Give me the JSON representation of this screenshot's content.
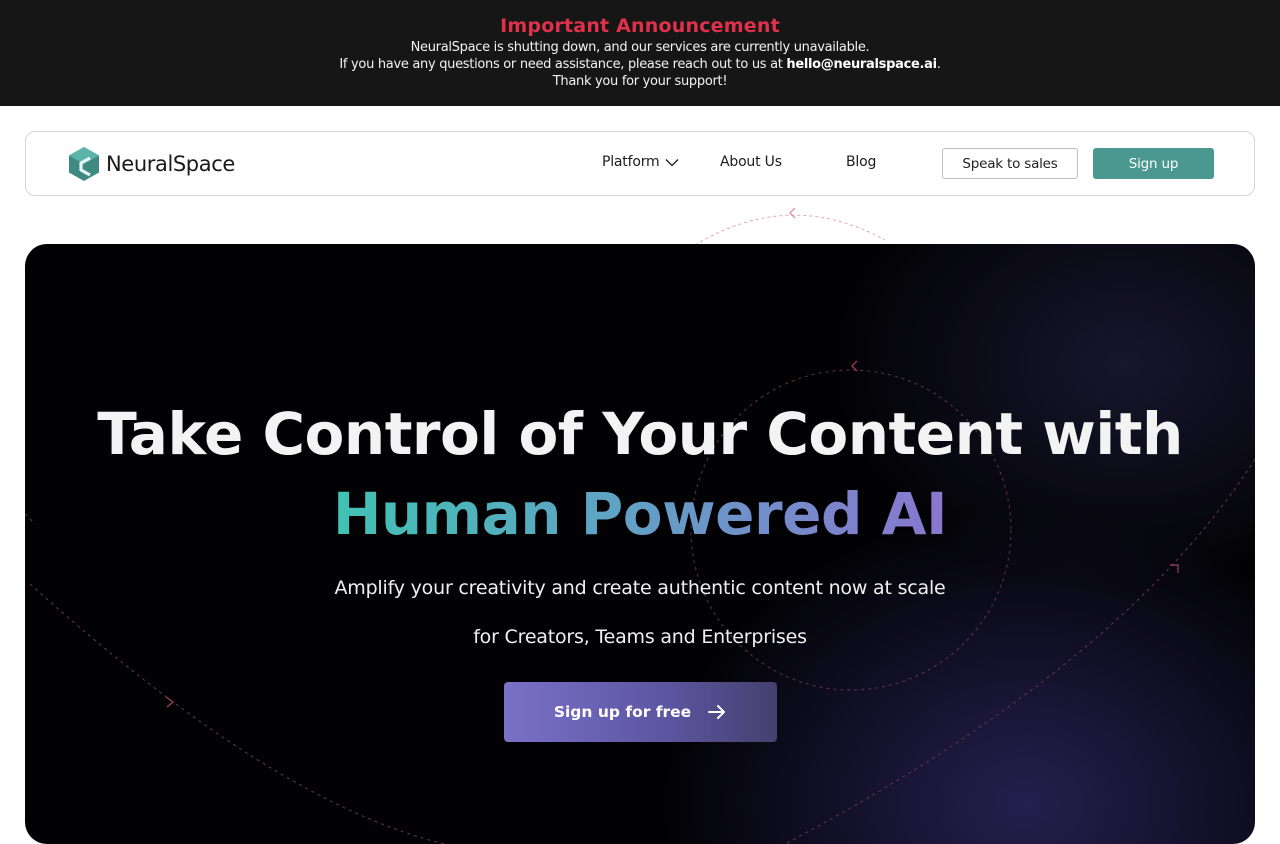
{
  "announcement": {
    "title": "Important Announcement",
    "line1": "NeuralSpace is shutting down, and our services are currently unavailable.",
    "line2_prefix": "If you have any questions or need assistance, please reach out to us at",
    "email": "hello@neuralspace.ai",
    "line2_suffix": ".",
    "line3": "Thank you for your support!"
  },
  "nav": {
    "brand": "NeuralSpace",
    "links": [
      {
        "label": "Platform",
        "has_dropdown": true
      },
      {
        "label": "About Us"
      },
      {
        "label": "Blog"
      }
    ],
    "speak_to_sales": "Speak to sales",
    "sign_up": "Sign up"
  },
  "hero": {
    "headline_line1": "Take Control of Your Content with",
    "headline_line2": "Human Powered AI",
    "subline1": "Amplify your creativity and create authentic content now at scale",
    "subline2": "for Creators, Teams and Enterprises",
    "cta_label": "Sign up for free"
  },
  "colors": {
    "banner_bg": "#161616",
    "announcement_title": "#e0314b",
    "brand_teal": "#4a9890",
    "gradient_start": "#41c2b4",
    "gradient_end": "#8a76d0",
    "hero_bg": "#020204"
  },
  "icons": {
    "logo": "neuralspace-hex-logo-icon",
    "dropdown": "chevron-down-icon",
    "cta": "arrow-right-icon"
  }
}
